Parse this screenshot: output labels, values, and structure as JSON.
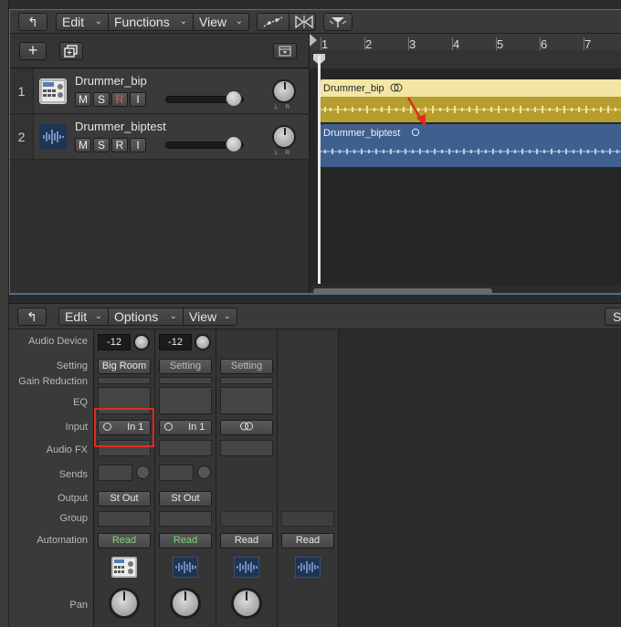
{
  "tracks_toolbar": {
    "back_label": "↰",
    "menus": [
      {
        "label": "Edit"
      },
      {
        "label": "Functions"
      },
      {
        "label": "View"
      }
    ]
  },
  "track_header": {
    "add_label": "+",
    "copy_label": "⧉",
    "catch_label": "⌄"
  },
  "tracks": [
    {
      "number": "1",
      "name": "Drummer_bip",
      "buttons": [
        "M",
        "S",
        "R",
        "I"
      ],
      "icon": "drum-machine-icon"
    },
    {
      "number": "2",
      "name": "Drummer_biptest",
      "buttons": [
        "M",
        "S",
        "R",
        "I"
      ],
      "icon": "waveform-icon"
    }
  ],
  "ruler": {
    "bars": [
      "1",
      "2",
      "3",
      "4",
      "5",
      "6",
      "7"
    ]
  },
  "regions": [
    {
      "name": "Drummer_bip",
      "color": "#f3e6a4",
      "wave_color": "#b69d2f"
    },
    {
      "name": "Drummer_biptest",
      "color": "#3f5f8f",
      "wave_color": "#2f4f80"
    }
  ],
  "mixer_toolbar": {
    "back_label": "↰",
    "menus": [
      {
        "label": "Edit"
      },
      {
        "label": "Options"
      },
      {
        "label": "View"
      }
    ],
    "right_label": "S"
  },
  "mixer_labels": {
    "audio_device": "Audio Device",
    "setting": "Setting",
    "gain_reduction": "Gain Reduction",
    "eq": "EQ",
    "input": "Input",
    "audio_fx": "Audio FX",
    "sends": "Sends",
    "output": "Output",
    "group": "Group",
    "automation": "Automation",
    "pan": "Pan"
  },
  "channels": [
    {
      "device": "-12",
      "setting": "Big Room",
      "input": "In 1",
      "output": "St Out",
      "automation": "Read"
    },
    {
      "device": "-12",
      "setting": "Setting",
      "input": "In 1",
      "output": "St Out",
      "automation": "Read"
    },
    {
      "setting": "Setting",
      "automation": "Read"
    },
    {
      "automation": "Read"
    }
  ]
}
